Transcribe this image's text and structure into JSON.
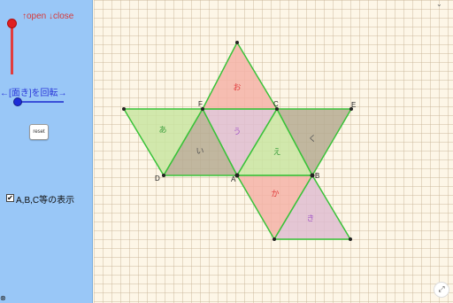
{
  "controls": {
    "open_close_label": "↑open ↓close",
    "rotate_label": "←[面き]を回転→",
    "reset_label": "reset",
    "show_labels_text": "A,B,C等の表示",
    "show_labels_checked": true,
    "checkbox_mark": "✔"
  },
  "icons": {
    "fullscreen": "fullscreen-icon",
    "bottom_left": "small-circle-icon"
  },
  "vertices": {
    "A": "A",
    "B": "B",
    "C": "C",
    "D": "D",
    "E": "E",
    "F": "F"
  },
  "faces": {
    "a": "あ",
    "i": "い",
    "u": "う",
    "e": "え",
    "o": "お",
    "ka": "か",
    "ki": "き",
    "ku": "く"
  },
  "colors": {
    "green_face": "#c9e5a1",
    "red_face": "#f4b3a7",
    "purple_face": "#dfbdd0",
    "brown_face": "#b6ab92",
    "edge": "#39c339",
    "red_text": "#e03a3a",
    "green_text": "#3fa03f",
    "purple_text": "#a55ac7",
    "brown_text": "#555"
  }
}
